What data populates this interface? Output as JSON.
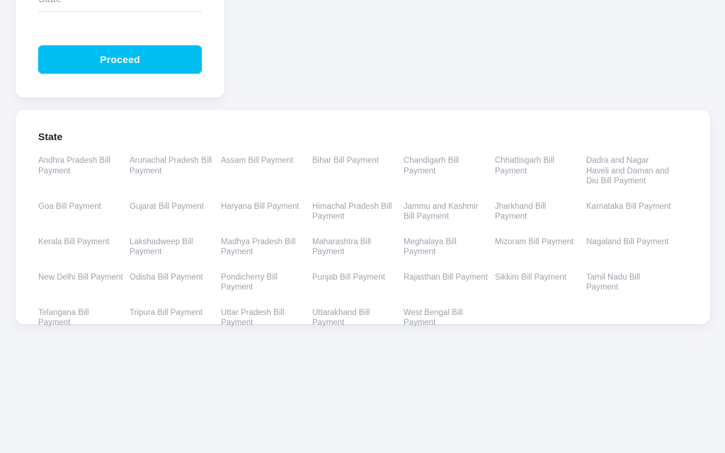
{
  "form": {
    "state_field": {
      "placeholder": "State",
      "value": ""
    },
    "proceed_label": "Proceed"
  },
  "links_section": {
    "title": "State",
    "items": [
      "Andhra Pradesh Bill Payment",
      "Arunachal Pradesh Bill Payment",
      "Assam Bill Payment",
      "Bihar Bill Payment",
      "Chandigarh Bill Payment",
      "Chhattisgarh Bill Payment",
      "Dadra and Nagar Haveli and Daman and Diu Bill Payment",
      "Goa Bill Payment",
      "Gujarat Bill Payment",
      "Haryana Bill Payment",
      "Himachal Pradesh Bill Payment",
      "Jammu and Kashmir Bill Payment",
      "Jharkhand Bill Payment",
      "Karnataka Bill Payment",
      "Kerala Bill Payment",
      "Lakshadweep Bill Payment",
      "Madhya Pradesh Bill Payment",
      "Maharashtra Bill Payment",
      "Meghalaya Bill Payment",
      "Mizoram Bill Payment",
      "Nagaland Bill Payment",
      "New Delhi Bill Payment",
      "Odisha Bill Payment",
      "Pondicherry Bill Payment",
      "Punjab Bill Payment",
      "Rajasthan Bill Payment",
      "Sikkim Bill Payment",
      "Tamil Nadu Bill Payment",
      "Telangana Bill Payment",
      "Tripura Bill Payment",
      "Uttar Pradesh Bill Payment",
      "Uttarakhand Bill Payment",
      "West Bengal Bill Payment"
    ]
  },
  "colors": {
    "page_background": "#f4f5f9",
    "card_background": "#ffffff",
    "accent": "#00bdf2",
    "link_text": "#9ea3ad",
    "title_text": "#202124",
    "placeholder_text": "#9aa0a6"
  }
}
